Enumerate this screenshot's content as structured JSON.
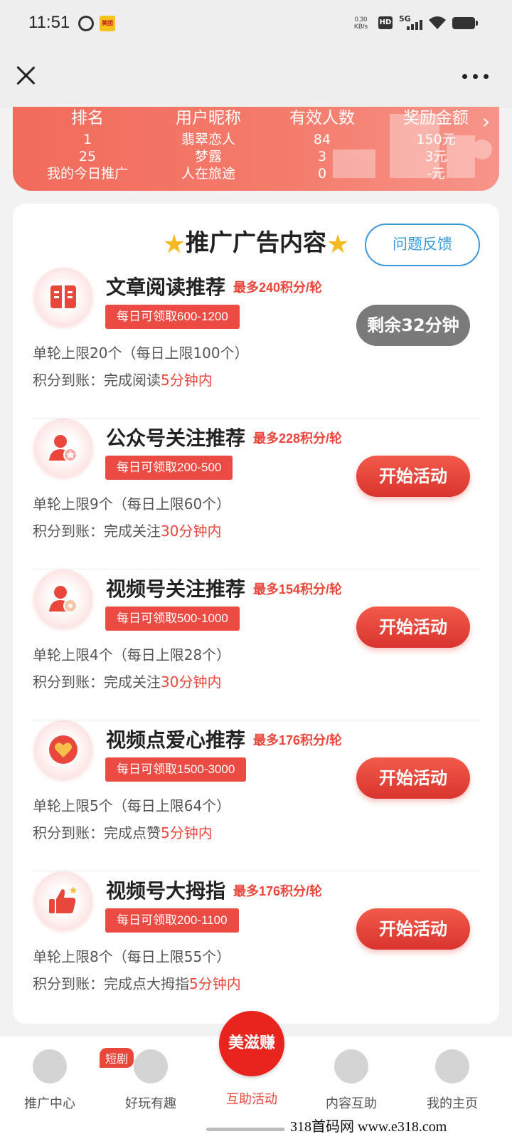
{
  "status_bar": {
    "time": "11:51",
    "net_speed": "0.30",
    "net_unit": "KB/s",
    "hd": "HD",
    "network": "5G",
    "app2_label": "美团"
  },
  "title_bar": {
    "close_icon": "close-icon",
    "more_icon": "more-icon"
  },
  "ranking": {
    "headers": [
      "排名",
      "用户昵称",
      "有效人数",
      "奖励金额"
    ],
    "rows": [
      [
        "1",
        "翡翠恋人",
        "84",
        "150元"
      ],
      [
        "25",
        "梦露",
        "3",
        "3元"
      ],
      [
        "我的今日推广",
        "人在旅途",
        "0",
        "-元"
      ]
    ]
  },
  "card": {
    "title": "推广广告内容",
    "feedback": "问题反馈"
  },
  "tasks": [
    {
      "name": "文章阅读推荐",
      "max": "最多240积分/轮",
      "daily": "每日可领取600-1200",
      "limit": "单轮上限20个（每日上限100个）",
      "arrive_prefix": "积分到账：完成阅读",
      "arrive_time": "5分钟内",
      "button": "剩余32分钟",
      "icon": "book-icon"
    },
    {
      "name": "公众号关注推荐",
      "max": "最多228积分/轮",
      "daily": "每日可领取200-500",
      "limit": "单轮上限9个（每日上限60个）",
      "arrive_prefix": "积分到账：完成关注",
      "arrive_time": "30分钟内",
      "button": "开始活动",
      "icon": "user-star-icon"
    },
    {
      "name": "视频号关注推荐",
      "max": "最多154积分/轮",
      "daily": "每日可领取500-1000",
      "limit": "单轮上限4个（每日上限28个）",
      "arrive_prefix": "积分到账：完成关注",
      "arrive_time": "30分钟内",
      "button": "开始活动",
      "icon": "user-flower-icon"
    },
    {
      "name": "视频点爱心推荐",
      "max": "最多176积分/轮",
      "daily": "每日可领取1500-3000",
      "limit": "单轮上限5个（每日上限64个）",
      "arrive_prefix": "积分到账：完成点赞",
      "arrive_time": "5分钟内",
      "button": "开始活动",
      "icon": "heart-icon"
    },
    {
      "name": "视频号大拇指",
      "max": "最多176积分/轮",
      "daily": "每日可领取200-1100",
      "limit": "单轮上限8个（每日上限55个）",
      "arrive_prefix": "积分到账：完成点大拇指",
      "arrive_time": "5分钟内",
      "button": "开始活动",
      "icon": "thumbs-up-icon"
    }
  ],
  "nav": {
    "items": [
      "推广中心",
      "好玩有趣",
      "互助活动",
      "内容互助",
      "我的主页"
    ],
    "badge": "短剧",
    "logo_text": "美滋赚"
  },
  "watermark": "318首码网   www.e318.com",
  "colors": {
    "accent": "#e9463c",
    "feedback": "#3a9ad9",
    "banner": "#f26b5c"
  }
}
